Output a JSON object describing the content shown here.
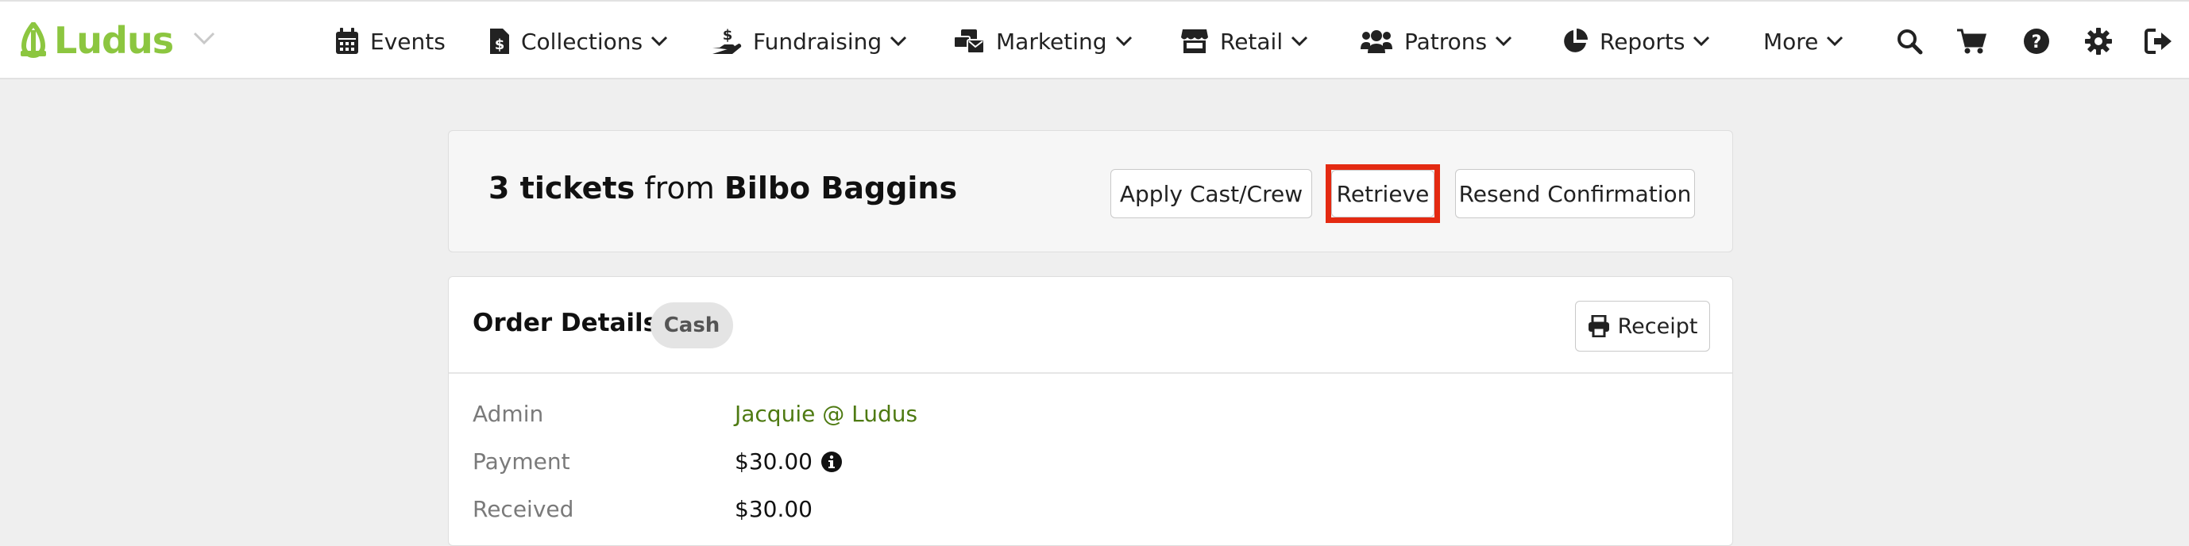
{
  "brand": {
    "name": "Ludus",
    "color": "#8cc640"
  },
  "nav": {
    "items": [
      {
        "label": "Events",
        "icon": "calendar-icon",
        "has_menu": false
      },
      {
        "label": "Collections",
        "icon": "document-dollar-icon",
        "has_menu": true
      },
      {
        "label": "Fundraising",
        "icon": "hand-dollar-icon",
        "has_menu": true
      },
      {
        "label": "Marketing",
        "icon": "mail-bulk-icon",
        "has_menu": true
      },
      {
        "label": "Retail",
        "icon": "store-icon",
        "has_menu": true
      },
      {
        "label": "Patrons",
        "icon": "users-icon",
        "has_menu": true
      },
      {
        "label": "Reports",
        "icon": "pie-chart-icon",
        "has_menu": true
      },
      {
        "label": "More",
        "icon": "",
        "has_menu": true
      }
    ],
    "utility_icons": [
      "search-icon",
      "cart-icon",
      "help-icon",
      "gear-icon",
      "sign-out-icon"
    ]
  },
  "order_header": {
    "count_text": "3 tickets",
    "from_text": "from",
    "patron_name": "Bilbo Baggins",
    "buttons": {
      "apply_cast_crew": "Apply Cast/Crew",
      "retrieve": "Retrieve",
      "resend_confirmation": "Resend Confirmation"
    },
    "highlight_color": "#e42a12"
  },
  "order_details": {
    "title": "Order Details",
    "payment_type_badge": "Cash",
    "receipt_label": "Receipt",
    "rows": [
      {
        "label": "Admin",
        "value": "Jacquie @ Ludus"
      },
      {
        "label": "Payment",
        "value": "$30.00"
      },
      {
        "label": "Received",
        "value": "$30.00"
      }
    ],
    "link_color": "#4e7a12"
  }
}
